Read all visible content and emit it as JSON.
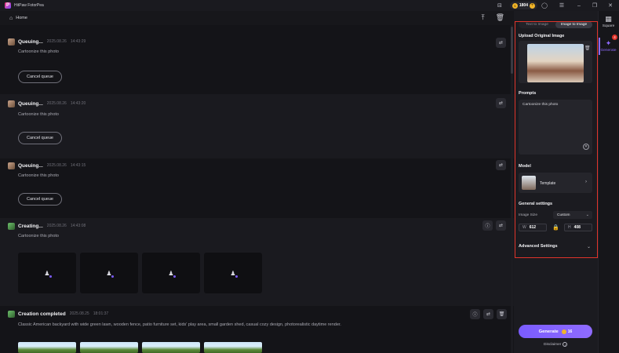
{
  "titlebar": {
    "app_title": "HitPaw FotorPea",
    "credits": "1804",
    "coin_symbol": "$",
    "plus_symbol": "+",
    "icons": [
      "gamepad-icon",
      "user-icon",
      "menu-icon",
      "minimize-icon",
      "maximize-icon",
      "close-icon"
    ]
  },
  "header": {
    "home_label": "Home"
  },
  "tasks": [
    {
      "status": "Queuing...",
      "date": "2025.08.26",
      "time": "14:43:29",
      "prompt": "Cartoonize this photo",
      "cancel_label": "Cancel queue"
    },
    {
      "status": "Queuing...",
      "date": "2025.08.26",
      "time": "14:43:20",
      "prompt": "Cartoonize this photo",
      "cancel_label": "Cancel queue"
    },
    {
      "status": "Queuing...",
      "date": "2025.08.26",
      "time": "14:43:15",
      "prompt": "Cartoonize this photo",
      "cancel_label": "Cancel queue"
    },
    {
      "status": "Creating...",
      "date": "2025.08.26",
      "time": "14:43:08",
      "prompt": "Cartoonize this photo"
    },
    {
      "status": "Creation completed",
      "date": "2025.08.25",
      "time": "18:01:37",
      "prompt": "Classic American backyard with wide green lawn, wooden fence, patio furniture set, kids' play area, small garden shed, casual cozy design, photorealistic daytime render."
    }
  ],
  "panel": {
    "tabs": [
      "Text to Image",
      "Image to Image"
    ],
    "active_tab": "Image to Image",
    "upload_title": "Upload Original Image",
    "prompts_title": "Prompts",
    "prompt_value": "Cartoonize this photo",
    "model_title": "Model",
    "model_name": "Template",
    "general_title": "General settings",
    "image_size_label": "Image Size",
    "image_size_value": "Custom",
    "width_letter": "W",
    "width_value": "612",
    "height_letter": "H",
    "height_value": "408",
    "advanced_label": "Advanced Settings",
    "generate_label": "Generate",
    "generate_cost": "16",
    "disclaimer": "Disclaimer"
  },
  "rnav": {
    "square_label": "Square",
    "generate_label": "Generate",
    "badge": "4"
  },
  "colors": {
    "accent": "#8f6bff",
    "highlight": "#e0342b",
    "coin": "#f0b429"
  }
}
